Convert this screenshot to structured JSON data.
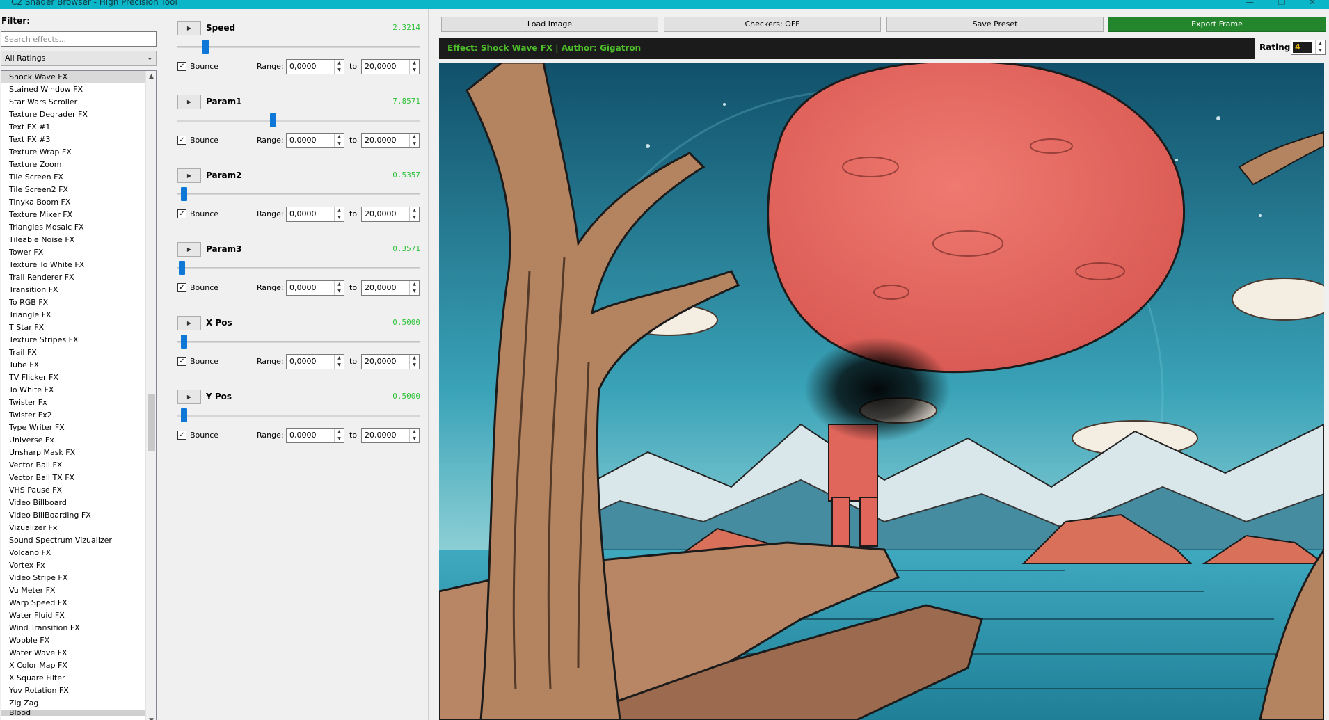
{
  "window": {
    "title": "C2 Shader Browser - High Precision Tool",
    "minimize": "—",
    "maximize": "❐",
    "close": "✕"
  },
  "sidebar": {
    "filter_label": "Filter:",
    "search_placeholder": "Search effects...",
    "rating_filter": "All Ratings",
    "items": [
      "Shock Wave FX",
      "Stained Window FX",
      "Star Wars Scroller",
      "Texture Degrader FX",
      "Text FX #1",
      "Text FX #3",
      "Texture Wrap FX",
      "Texture Zoom",
      "Tile Screen FX",
      "Tile Screen2 FX",
      "Tinyka Boom FX",
      "Texture Mixer FX",
      "Triangles Mosaic FX",
      "Tileable Noise FX",
      "Tower FX",
      "Texture To White FX",
      "Trail Renderer FX",
      "Transition FX",
      "To RGB FX",
      "Triangle FX",
      "T Star FX",
      "Texture Stripes FX",
      "Trail FX",
      "Tube FX",
      "TV Flicker FX",
      "To White FX",
      "Twister Fx",
      "Twister Fx2",
      "Type Writer FX",
      "Universe Fx",
      "Unsharp Mask FX",
      "Vector Ball FX",
      "Vector Ball TX FX",
      "VHS Pause FX",
      "Video Billboard",
      "Video BillBoarding FX",
      "Vizualizer Fx",
      "Sound Spectrum Vizualizer",
      "Volcano FX",
      "Vortex Fx",
      "Video Stripe FX",
      "Vu Meter FX",
      "Warp Speed FX",
      "Water Fluid FX",
      "Wind Transition FX",
      "Wobble FX",
      "Water Wave FX",
      "X Color Map FX",
      "X Square Filter",
      "Yuv Rotation FX",
      "Zig Zag",
      "Blood"
    ],
    "selected_index": 0
  },
  "params": [
    {
      "name": "Speed",
      "value": "2.3214",
      "fraction": 0.116,
      "bounce_label": "Bounce",
      "checked": true,
      "range_label": "Range:",
      "from": "0,0000",
      "to_label": "to",
      "to": "20,0000"
    },
    {
      "name": "Param1",
      "value": "7.8571",
      "fraction": 0.393,
      "bounce_label": "Bounce",
      "checked": true,
      "range_label": "Range:",
      "from": "0,0000",
      "to_label": "to",
      "to": "20,0000"
    },
    {
      "name": "Param2",
      "value": "0.5357",
      "fraction": 0.027,
      "bounce_label": "Bounce",
      "checked": true,
      "range_label": "Range:",
      "from": "0,0000",
      "to_label": "to",
      "to": "20,0000"
    },
    {
      "name": "Param3",
      "value": "0.3571",
      "fraction": 0.018,
      "bounce_label": "Bounce",
      "checked": true,
      "range_label": "Range:",
      "from": "0,0000",
      "to_label": "to",
      "to": "20,0000"
    },
    {
      "name": "X Pos",
      "value": "0.5000",
      "fraction": 0.025,
      "bounce_label": "Bounce",
      "checked": true,
      "range_label": "Range:",
      "from": "0,0000",
      "to_label": "to",
      "to": "20,0000"
    },
    {
      "name": "Y Pos",
      "value": "0.5000",
      "fraction": 0.025,
      "bounce_label": "Bounce",
      "checked": true,
      "range_label": "Range:",
      "from": "0,0000",
      "to_label": "to",
      "to": "20,0000"
    }
  ],
  "toolbar": {
    "load_image": "Load Image",
    "checkers": "Checkers: OFF",
    "save_preset": "Save Preset",
    "export_frame": "Export Frame"
  },
  "info": {
    "text": "Effect: Shock Wave FX | Author: Gigatron",
    "rating_label": "Rating:",
    "rating_value": "4"
  },
  "colors": {
    "accent": "#0ab6c8",
    "export": "#23862d",
    "param_value": "#30c23a",
    "info_text": "#4dbd2a",
    "slider": "#0f78d7"
  },
  "icons": {
    "play": "▶",
    "check": "✓",
    "chevron_down": "⌄",
    "scroll_up": "▲",
    "scroll_down": "▼",
    "spin_up": "▲",
    "spin_down": "▼"
  }
}
